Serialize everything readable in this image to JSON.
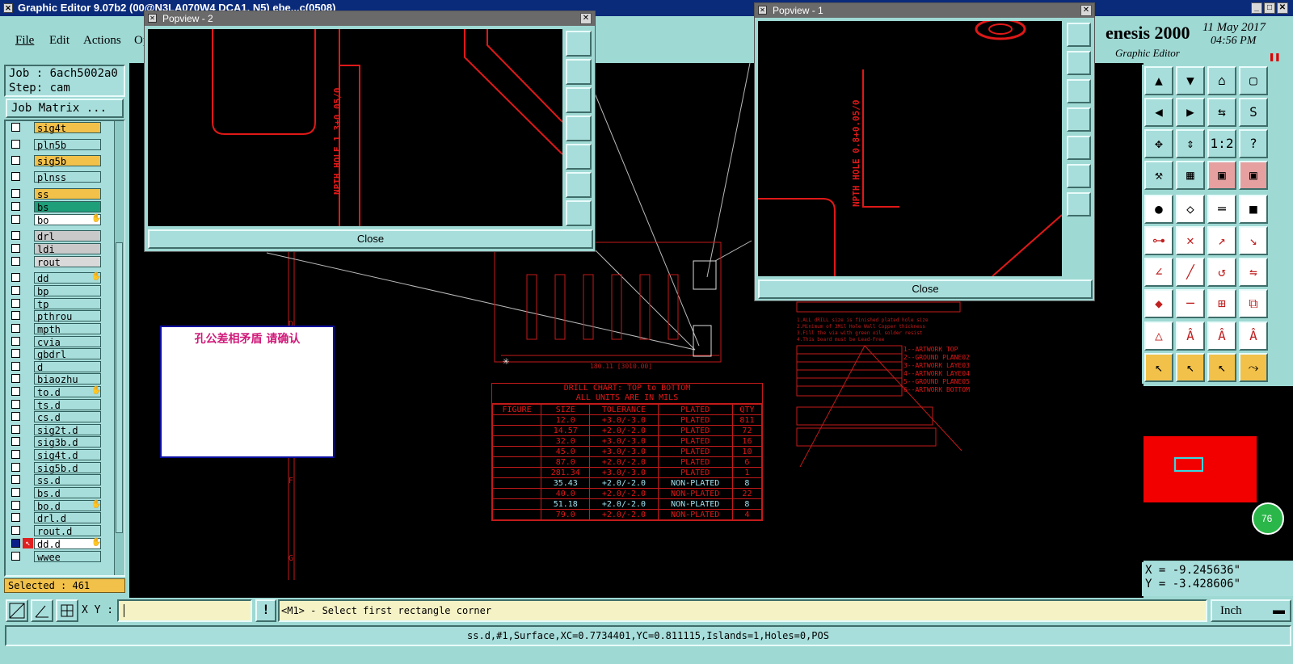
{
  "window": {
    "title": "Graphic Editor 9.07b2 (00@N3LA070W4 DCA1, N5) ebe...c(0508)"
  },
  "menu": [
    "File",
    "Edit",
    "Actions",
    "Op"
  ],
  "brand": {
    "name": "enesis 2000",
    "subtitle": "Graphic Editor",
    "date": "11 May 2017",
    "time": "04:56 PM"
  },
  "job": {
    "job_label": "Job : 6ach5002a0",
    "step_label": "Step: cam",
    "matrix_button": "Job Matrix ..."
  },
  "layers": [
    {
      "name": "sig4t",
      "color": "#f2c14a"
    },
    {
      "name": "pln5b",
      "color": "#a7dedb"
    },
    {
      "name": "sig5b",
      "color": "#f2c14a"
    },
    {
      "name": "plnss",
      "color": "#a7dedb"
    },
    {
      "name": "ss",
      "color": "#f2c14a"
    },
    {
      "name": "bs",
      "color": "#1f9e7a"
    },
    {
      "name": "bo",
      "color": "#ffffff",
      "mark": "hand"
    },
    {
      "name": "drl",
      "color": "#c9c9c9"
    },
    {
      "name": "ldi",
      "color": "#c9c9c9"
    },
    {
      "name": "rout",
      "color": "#d9d9d9"
    },
    {
      "name": "dd",
      "color": "#a7dedb",
      "mark": "hand"
    },
    {
      "name": "bp",
      "color": "#a7dedb"
    },
    {
      "name": "tp",
      "color": "#a7dedb"
    },
    {
      "name": "pthrou",
      "color": "#a7dedb"
    },
    {
      "name": "mpth",
      "color": "#a7dedb"
    },
    {
      "name": "cvia",
      "color": "#a7dedb"
    },
    {
      "name": "gbdrl",
      "color": "#a7dedb"
    },
    {
      "name": "d",
      "color": "#a7dedb"
    },
    {
      "name": "biaozhu",
      "color": "#a7dedb"
    },
    {
      "name": "to.d",
      "color": "#a7dedb",
      "mark": "hand"
    },
    {
      "name": "ts.d",
      "color": "#a7dedb"
    },
    {
      "name": "cs.d",
      "color": "#a7dedb"
    },
    {
      "name": "sig2t.d",
      "color": "#a7dedb"
    },
    {
      "name": "sig3b.d",
      "color": "#a7dedb"
    },
    {
      "name": "sig4t.d",
      "color": "#a7dedb"
    },
    {
      "name": "sig5b.d",
      "color": "#a7dedb"
    },
    {
      "name": "ss.d",
      "color": "#a7dedb"
    },
    {
      "name": "bs.d",
      "color": "#a7dedb"
    },
    {
      "name": "bo.d",
      "color": "#a7dedb",
      "mark": "hand"
    },
    {
      "name": "drl.d",
      "color": "#a7dedb"
    },
    {
      "name": "rout.d",
      "color": "#a7dedb"
    },
    {
      "name": "dd.d",
      "color": "#ffffff",
      "mark": "hand"
    },
    {
      "name": "wwee",
      "color": "#a7dedb"
    }
  ],
  "selected": "Selected : 461",
  "popview2": {
    "title": "Popview - 2",
    "close": "Close",
    "note": "NPTH HOLE 1.3+0.05/0"
  },
  "popview1": {
    "title": "Popview - 1",
    "close": "Close",
    "note": "NPTH HOLE 0.8+0.05/0"
  },
  "note_box": {
    "text": "孔公差相矛盾 请确认"
  },
  "drill_chart": {
    "title1": "DRILL CHART: TOP to BOTTOM",
    "title2": "ALL UNITS ARE IN MILS",
    "headers": [
      "FIGURE",
      "SIZE",
      "TOLERANCE",
      "PLATED",
      "QTY"
    ],
    "rows": [
      [
        "",
        "12.0",
        "+3.0/-3.0",
        "PLATED",
        "811"
      ],
      [
        "",
        "14.57",
        "+2.0/-2.0",
        "PLATED",
        "72"
      ],
      [
        "",
        "32.0",
        "+3.0/-3.0",
        "PLATED",
        "16"
      ],
      [
        "",
        "45.0",
        "+3.0/-3.0",
        "PLATED",
        "10"
      ],
      [
        "",
        "87.0",
        "+2.0/-2.0",
        "PLATED",
        "6"
      ],
      [
        "",
        "281.34",
        "+3.0/-3.0",
        "PLATED",
        "1"
      ],
      [
        "",
        "35.43",
        "+2.0/-2.0",
        "NON-PLATED",
        "8"
      ],
      [
        "",
        "40.0",
        "+2.0/-2.0",
        "NON-PLATED",
        "22"
      ],
      [
        "",
        "51.18",
        "+2.0/-2.0",
        "NON-PLATED",
        "8"
      ],
      [
        "",
        "79.0",
        "+2.0/-2.0",
        "NON-PLATED",
        "4"
      ]
    ]
  },
  "layer_legend": [
    "1--ARTWORK TOP",
    "2--GROUND PLANE02",
    "3--ARTWORK LAYE03",
    "4--ARTWORK LAYE04",
    "5--GROUND PLANE05",
    "6--ARTWORK BOTTOM"
  ],
  "coords": {
    "x": "X = -9.245636\"",
    "y": "Y = -3.428606\""
  },
  "badge": "76",
  "xy_label": "X Y :",
  "prompt": "<M1> - Select first rectangle corner",
  "units": "Inch",
  "status": "ss.d,#1,Surface,XC=0.7734401,YC=0.811115,Islands=1,Holes=0,POS",
  "ruler_letters": [
    "D",
    "E",
    "F",
    "G"
  ]
}
